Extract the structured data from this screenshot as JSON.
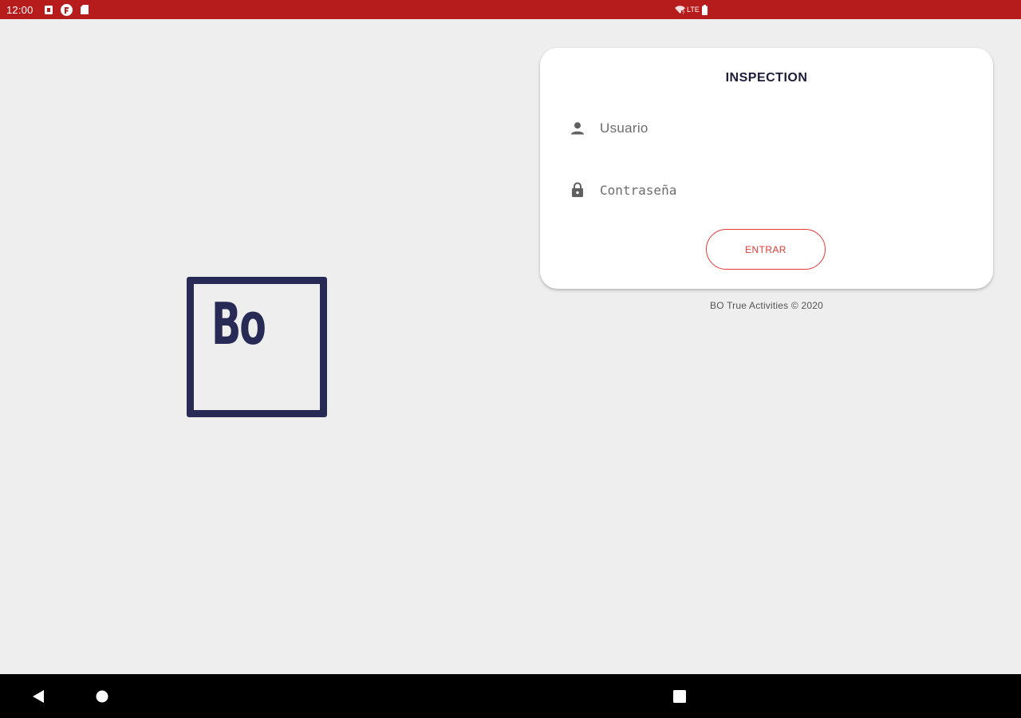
{
  "status_bar": {
    "time": "12:00",
    "left_icons": [
      "notification-icon",
      "app-icon",
      "sd-card-icon"
    ],
    "network_label": "LTE",
    "right_icons": [
      "wifi-icon",
      "signal-icon",
      "battery-icon"
    ],
    "background_color": "#b71c1c"
  },
  "logo": {
    "text": "Bo",
    "color": "#272a54"
  },
  "login_card": {
    "title": "INSPECTION",
    "username": {
      "icon": "person-icon",
      "value": "",
      "placeholder": "Usuario"
    },
    "password": {
      "icon": "lock-icon",
      "value": "",
      "placeholder": "Contraseña"
    },
    "submit_label": "ENTRAR",
    "accent_color": "#e53935"
  },
  "footer": {
    "text": "BO True Activities © 2020"
  },
  "nav_bar": {
    "buttons": [
      "back-icon",
      "home-icon",
      "recents-icon"
    ]
  }
}
